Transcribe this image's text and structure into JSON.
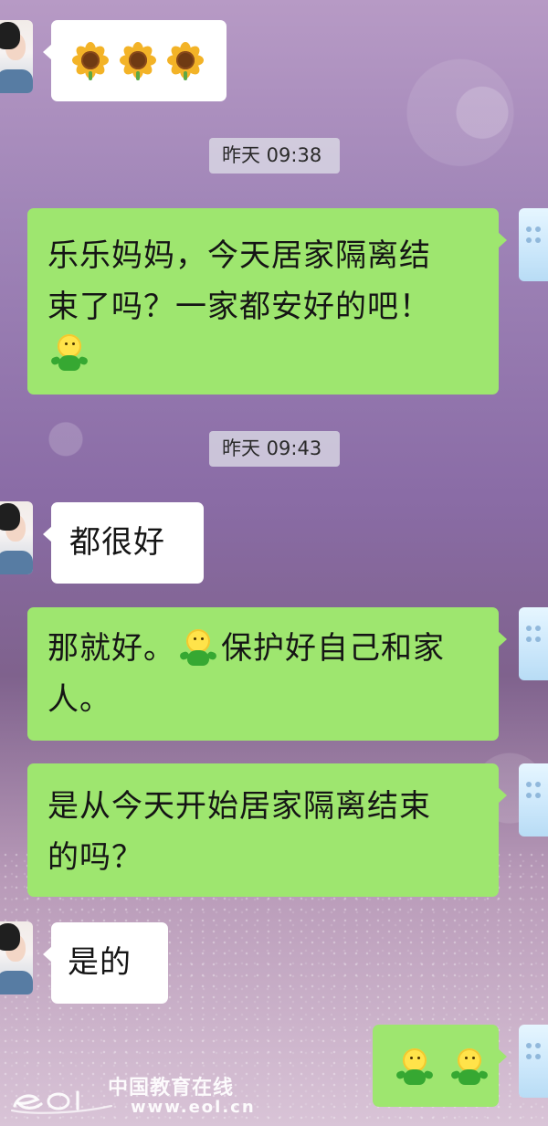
{
  "timestamps": {
    "yesterday_0938": "昨天 09:38",
    "yesterday_0943": "昨天 09:43"
  },
  "messages": {
    "reply_1": "都很好",
    "reply_2": "是的",
    "sent_1_line_1": "乐乐妈妈，今天居家隔离结",
    "sent_1_line_2": "束了吗？一家都安好的吧！",
    "sent_2_line_1_before_emoji": "那就好。",
    "sent_2_line_1_after_emoji": "保护好自己和家",
    "sent_2_line_2": "人。",
    "sent_3_line_1": "是从今天开始居家隔离结束",
    "sent_3_line_2": "的吗？"
  },
  "icons": {
    "sunflower": "sunflower-icon",
    "sprout": "sprout-icon"
  },
  "watermark": {
    "logo_text": "eol",
    "title": "中国教育在线",
    "url": "www.eol.cn"
  }
}
